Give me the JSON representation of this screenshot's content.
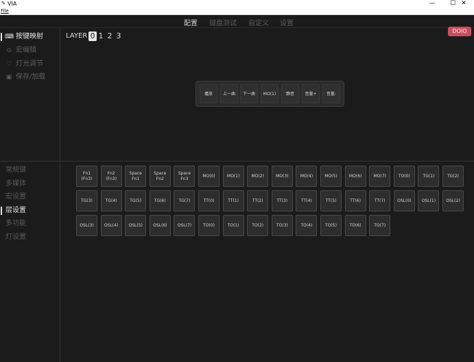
{
  "window": {
    "app_icon": "via-logo-icon",
    "title": "VIA",
    "minimize": "—",
    "maximize": "☐",
    "close": "✕"
  },
  "menubar": {
    "file": "File"
  },
  "topnav": {
    "tabs": [
      {
        "label": "配置"
      },
      {
        "label": "键盘测试"
      },
      {
        "label": "自定义"
      },
      {
        "label": "设置"
      }
    ],
    "active_index": 0
  },
  "sidebar": {
    "items": [
      {
        "label": "按键映射",
        "icon": "keyboard-icon",
        "glyph": "⌨"
      },
      {
        "label": "宏编辑",
        "icon": "gear-icon",
        "glyph": "⊙"
      },
      {
        "label": "灯光调节",
        "icon": "bulb-icon",
        "glyph": "♡"
      },
      {
        "label": "保存/加载",
        "icon": "save-icon",
        "glyph": "▣"
      }
    ],
    "active_index": 0
  },
  "layers": {
    "label": "LAYER",
    "options": [
      "0",
      "1",
      "2",
      "3"
    ],
    "selected": "0"
  },
  "badge": {
    "text": "DOIO",
    "color": "#c94f5e"
  },
  "keyboard": {
    "keys": [
      "播放",
      "上一曲",
      "下一曲",
      "MO(1)",
      "静音",
      "音量+",
      "音量-"
    ]
  },
  "categories": {
    "items": [
      "常规键",
      "多媒体",
      "宏设置",
      "层设置",
      "多功能",
      "灯设置"
    ],
    "active_index": 3
  },
  "key_grid": {
    "keys": [
      "Fn1\n(Fn3)",
      "Fn2\n(Fn3)",
      "Space\nFn1",
      "Space\nFn2",
      "Space\nFn3",
      "MO(0)",
      "MO(1)",
      "MO(2)",
      "MO(3)",
      "MO(4)",
      "MO(5)",
      "MO(6)",
      "MO(7)",
      "TO(0)",
      "TG(1)",
      "TG(2)",
      "TG(3)",
      "TG(4)",
      "TG(5)",
      "TG(6)",
      "TG(7)",
      "TT(0)",
      "TT(1)",
      "TT(2)",
      "TT(3)",
      "TT(4)",
      "TT(5)",
      "TT(6)",
      "TT(7)",
      "OSL(0)",
      "OSL(1)",
      "OSL(2)",
      "OSL(3)",
      "OSL(4)",
      "OSL(5)",
      "OSL(6)",
      "OSL(7)",
      "TO(0)",
      "TO(1)",
      "TO(2)",
      "TO(3)",
      "TO(4)",
      "TO(5)",
      "TO(6)",
      "TO(7)"
    ]
  }
}
